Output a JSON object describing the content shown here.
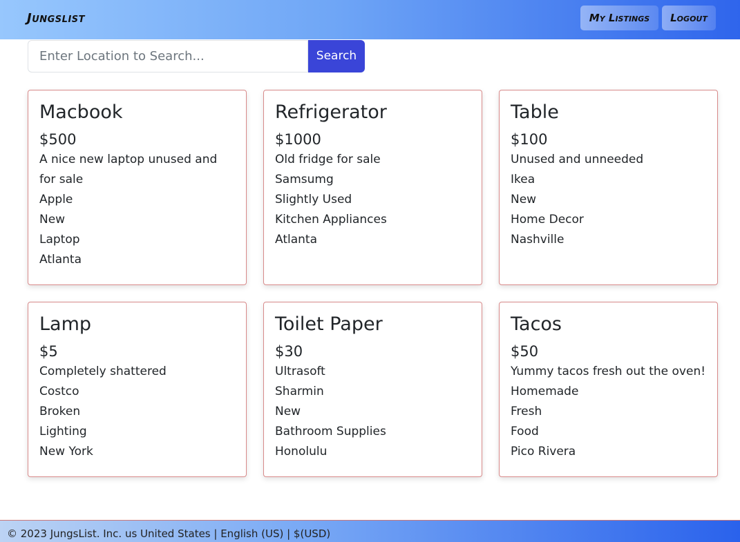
{
  "nav": {
    "brand": "Jungslist",
    "my_listings_label": "My Listings",
    "logout_label": "Logout"
  },
  "search": {
    "placeholder": "Enter Location to Search...",
    "value": "",
    "button_label": "Search"
  },
  "listings": [
    {
      "title": "Macbook",
      "price": "$500",
      "description": "A nice new laptop unused and for sale",
      "brand": "Apple",
      "condition": "New",
      "category": "Laptop",
      "location": "Atlanta"
    },
    {
      "title": "Refrigerator",
      "price": "$1000",
      "description": "Old fridge for sale",
      "brand": "Samsumg",
      "condition": "Slightly Used",
      "category": "Kitchen Appliances",
      "location": "Atlanta"
    },
    {
      "title": "Table",
      "price": "$100",
      "description": "Unused and unneeded",
      "brand": "Ikea",
      "condition": "New",
      "category": "Home Decor",
      "location": "Nashville"
    },
    {
      "title": "Lamp",
      "price": "$5",
      "description": "Completely shattered",
      "brand": "Costco",
      "condition": "Broken",
      "category": "Lighting",
      "location": "New York"
    },
    {
      "title": "Toilet Paper",
      "price": "$30",
      "description": "Ultrasoft",
      "brand": "Sharmin",
      "condition": "New",
      "category": "Bathroom Supplies",
      "location": "Honolulu"
    },
    {
      "title": "Tacos",
      "price": "$50",
      "description": "Yummy tacos fresh out the oven!",
      "brand": "Homemade",
      "condition": "Fresh",
      "category": "Food",
      "location": "Pico Rivera"
    }
  ],
  "footer": {
    "text": "© 2023 JungsList. Inc. us United States | English (US) | $(USD)"
  },
  "colors": {
    "search_button": "#3a45d8",
    "card_border": "#d88a8a",
    "navbar_gradient_start": "#97c7fd",
    "navbar_gradient_end": "#2f65ec"
  }
}
